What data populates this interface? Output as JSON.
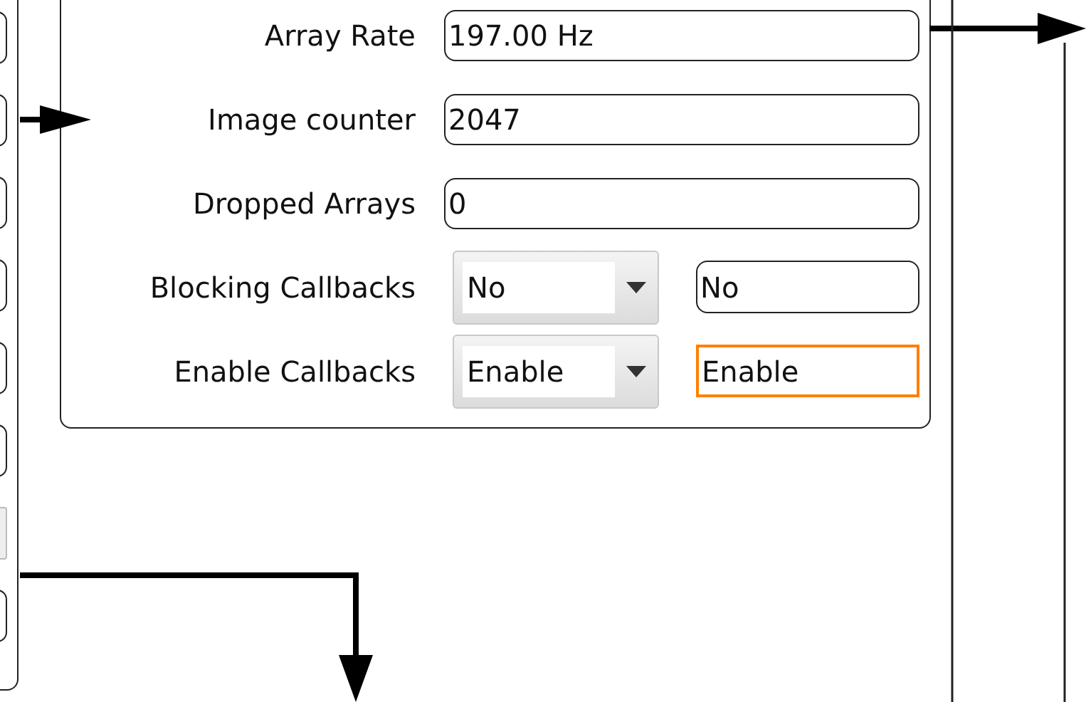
{
  "rows": [
    {
      "kind": "field",
      "label": "Array Rate",
      "value": "197.00 Hz"
    },
    {
      "kind": "field",
      "label": "Image counter",
      "value": "2047"
    },
    {
      "kind": "field",
      "label": "Dropped Arrays",
      "value": "0"
    },
    {
      "kind": "menu",
      "label": "Blocking Callbacks",
      "choice": "No",
      "readback": "No",
      "highlighted": false
    },
    {
      "kind": "menu",
      "label": "Enable Callbacks",
      "choice": "Enable",
      "readback": "Enable",
      "highlighted": true
    }
  ]
}
